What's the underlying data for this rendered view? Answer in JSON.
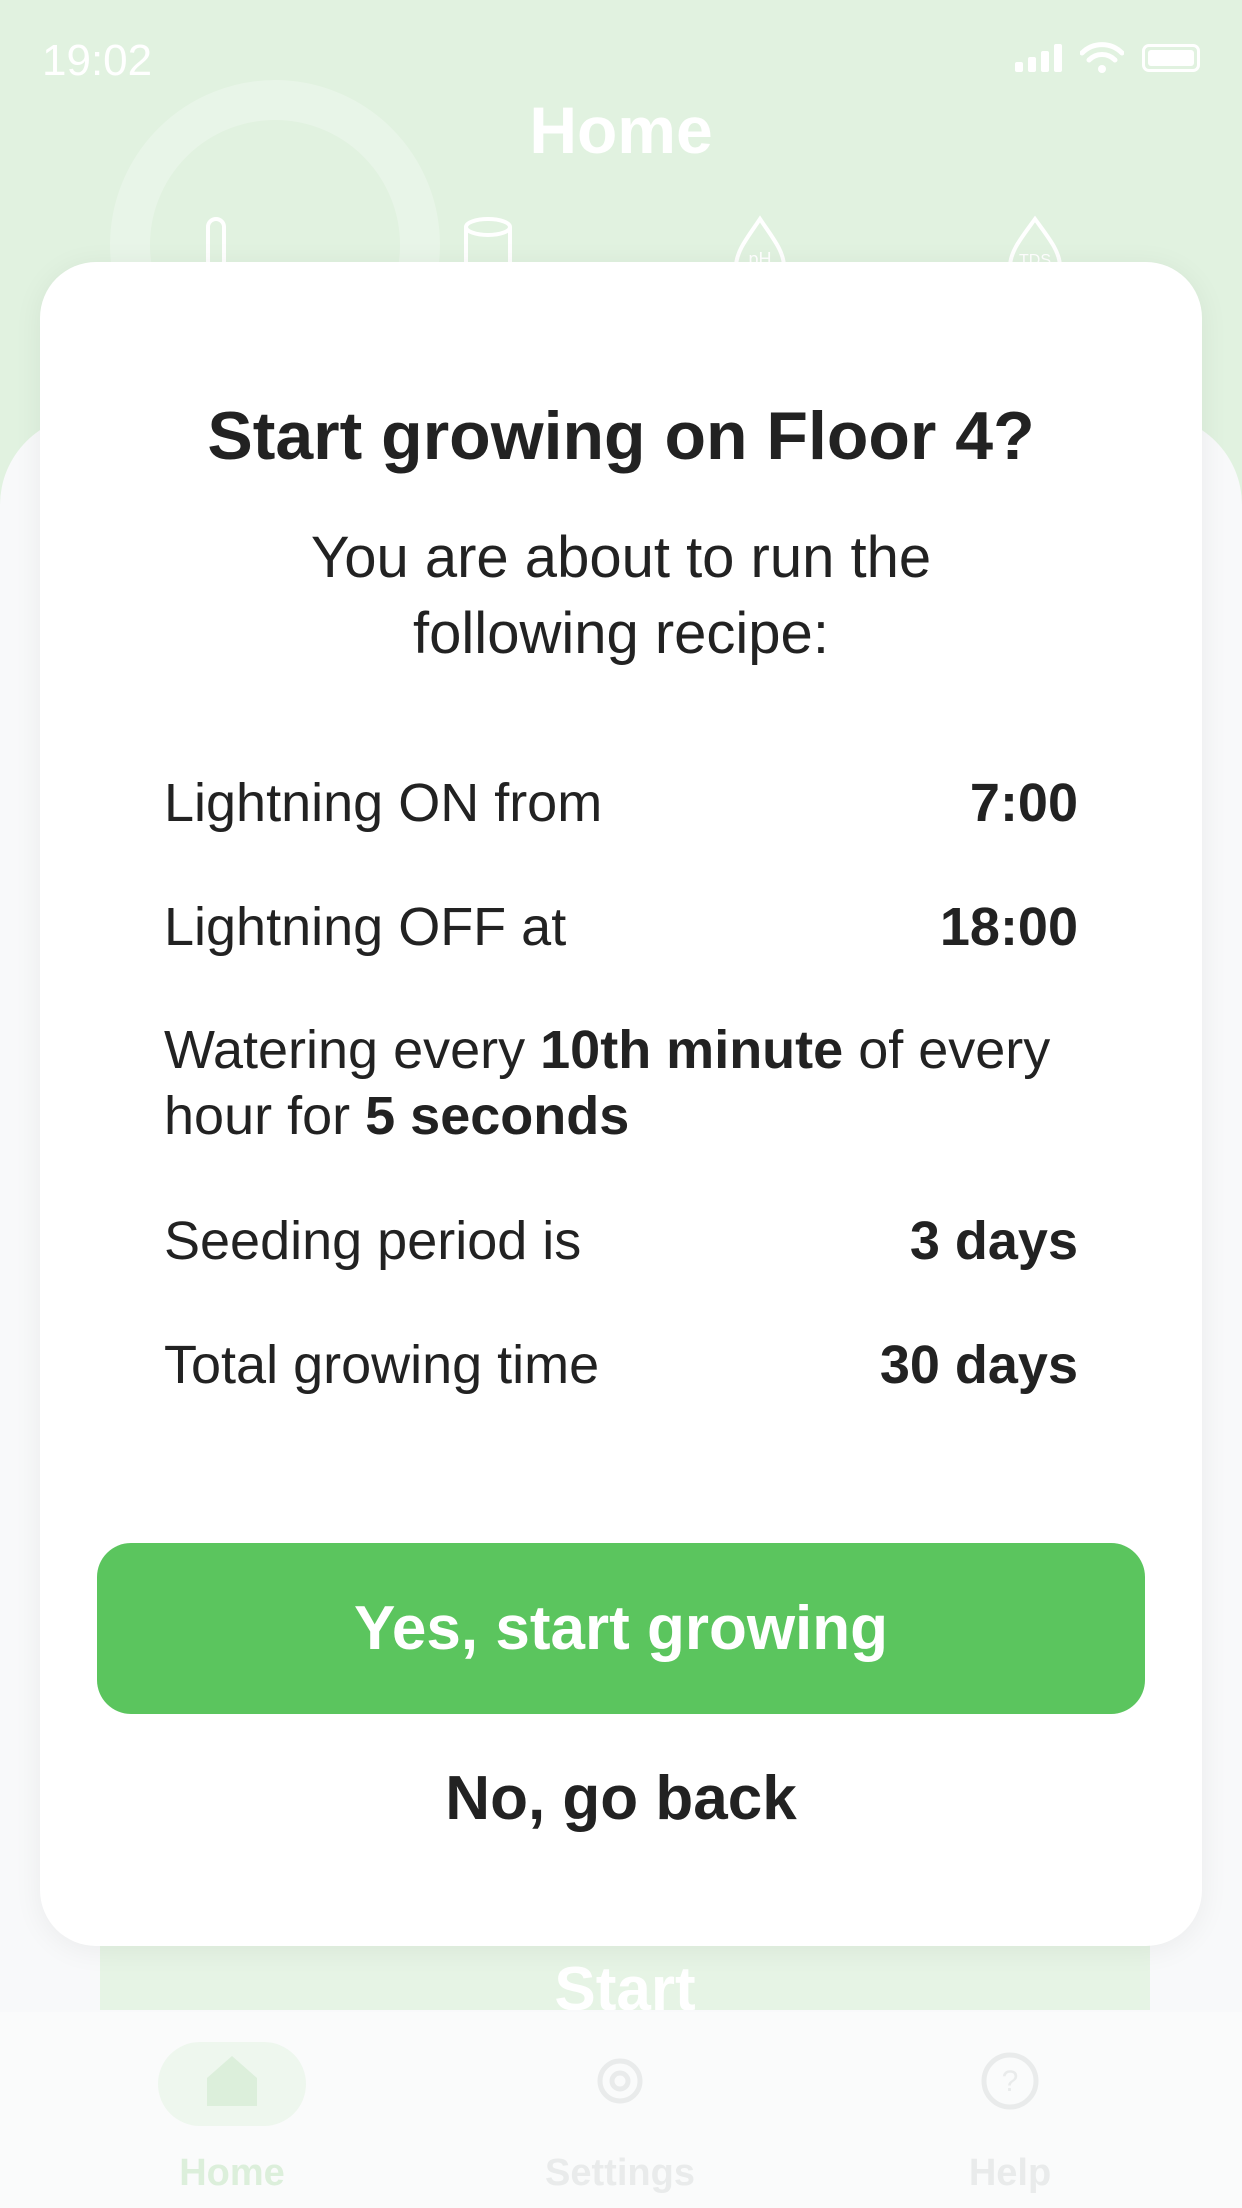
{
  "status_bar": {
    "time": "19:02"
  },
  "background": {
    "title": "Home",
    "start_button_label": "Start",
    "sensors": [
      {
        "icon": "thermometer-icon"
      },
      {
        "icon": "water-tank-icon"
      },
      {
        "icon": "ph-drop-icon",
        "label": "pH"
      },
      {
        "icon": "tds-drop-icon",
        "label": "TDS"
      }
    ]
  },
  "tabs": [
    {
      "label": "Home",
      "icon": "home-icon",
      "active": true
    },
    {
      "label": "Settings",
      "icon": "gear-icon",
      "active": false
    },
    {
      "label": "Help",
      "icon": "help-icon",
      "active": false
    }
  ],
  "modal": {
    "title": "Start growing on Floor 4?",
    "subtitle": "You are about to run the following recipe:",
    "light_on": {
      "label": "Lightning ON from",
      "value": "7:00"
    },
    "light_off": {
      "label": "Lightning OFF at",
      "value": "18:00"
    },
    "watering": {
      "prefix": "Watering every",
      "minute": "10th minute",
      "middle": "of every hour for",
      "duration": "5 seconds"
    },
    "seeding": {
      "label": "Seeding period is",
      "value": "3 days"
    },
    "total": {
      "label": "Total growing time",
      "value": "30 days"
    },
    "confirm_label": "Yes, start growing",
    "cancel_label": "No, go back"
  },
  "colors": {
    "accent": "#5bc55e",
    "header_bg": "#e1f2e0"
  }
}
